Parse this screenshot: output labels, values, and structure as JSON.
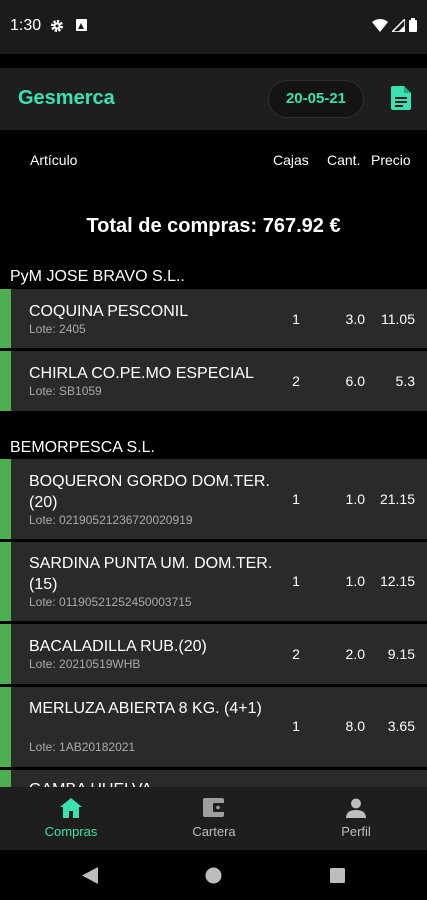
{
  "status_bar": {
    "time": "1:30"
  },
  "app_bar": {
    "title": "Gesmerca",
    "date": "20-05-21"
  },
  "columns": {
    "articulo": "Artículo",
    "cajas": "Cajas",
    "cant": "Cant.",
    "precio": "Precio"
  },
  "total": "Total de compras: 767.92 €",
  "suppliers": [
    {
      "name": "PyM JOSE BRAVO S.L..",
      "items": [
        {
          "name": "COQUINA PESCONIL",
          "lote": "Lote: 2405",
          "cajas": "1",
          "cant": "3.0",
          "precio": "11.05"
        },
        {
          "name": "CHIRLA CO.PE.MO ESPECIAL",
          "lote": "Lote: SB1059",
          "cajas": "2",
          "cant": "6.0",
          "precio": "5.3"
        }
      ]
    },
    {
      "name": "BEMORPESCA  S.L.",
      "items": [
        {
          "name": "BOQUERON GORDO DOM.TER.(20)",
          "lote": "Lote: 02190521236720020919",
          "cajas": "1",
          "cant": "1.0",
          "precio": "21.15"
        },
        {
          "name": "SARDINA PUNTA UM. DOM.TER.(15)",
          "lote": "Lote: 01190521252450003715",
          "cajas": "1",
          "cant": "1.0",
          "precio": "12.15"
        },
        {
          "name": "BACALADILLA RUB.(20)",
          "lote": "Lote: 20210519WHB",
          "cajas": "2",
          "cant": "2.0",
          "precio": "9.15"
        },
        {
          "name": "MERLUZA ABIERTA 8 KG. (4+1)",
          "lote": "Lote: 1AB20182021",
          "cajas": "1",
          "cant": "8.0",
          "precio": "3.65"
        },
        {
          "name": "GAMBA HUELVA",
          "lote": "",
          "cajas": "",
          "cant": "",
          "precio": ""
        }
      ]
    }
  ],
  "bottom_nav": {
    "compras": "Compras",
    "cartera": "Cartera",
    "perfil": "Perfil"
  },
  "colors": {
    "accent": "#39e2b0",
    "row_marker": "#4caf50",
    "row_bg": "#2a2a2a"
  },
  "icons": [
    "gear-icon",
    "android-a-icon",
    "wifi-icon",
    "signal-icon",
    "battery-icon",
    "document-icon",
    "home-icon",
    "wallet-icon",
    "person-icon",
    "back-icon",
    "home-circle-icon",
    "recents-icon"
  ]
}
